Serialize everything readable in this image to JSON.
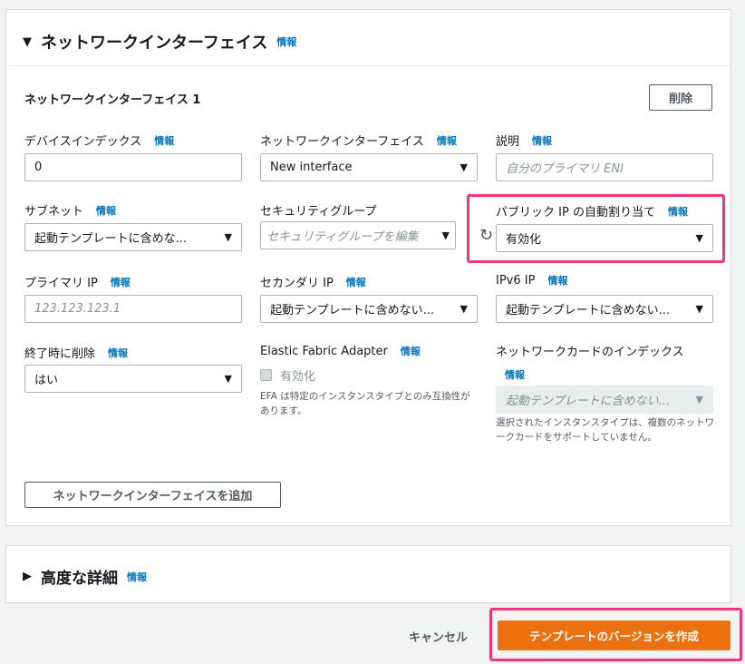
{
  "section": {
    "title": "ネットワークインターフェイス",
    "info": "情報"
  },
  "interface": {
    "title": "ネットワークインターフェイス 1",
    "remove_label": "削除"
  },
  "fields": {
    "device_index": {
      "label": "デバイスインデックス",
      "info": "情報",
      "value": "0"
    },
    "network_interface": {
      "label": "ネットワークインターフェイス",
      "info": "情報",
      "value": "New interface"
    },
    "description": {
      "label": "説明",
      "info": "情報",
      "placeholder": "自分のプライマリ ENI"
    },
    "subnet": {
      "label": "サブネット",
      "info": "情報",
      "value": "起動テンプレートに含めな..."
    },
    "security_group": {
      "label": "セキュリティグループ",
      "placeholder": "セキュリティグループを編集"
    },
    "public_ip": {
      "label": "パブリック IP の自動割り当て",
      "info": "情報",
      "value": "有効化"
    },
    "primary_ip": {
      "label": "プライマリ IP",
      "info": "情報",
      "placeholder": "123.123.123.1"
    },
    "secondary_ip": {
      "label": "セカンダリ IP",
      "info": "情報",
      "value": "起動テンプレートに含めない..."
    },
    "ipv6_ip": {
      "label": "IPv6 IP",
      "info": "情報",
      "value": "起動テンプレートに含めない..."
    },
    "delete_on_termination": {
      "label": "終了時に削除",
      "info": "情報",
      "value": "はい"
    },
    "efa": {
      "label": "Elastic Fabric Adapter",
      "info": "情報",
      "checkbox_label": "有効化",
      "description": "EFA は特定のインスタンスタイプとのみ互換性があります。"
    },
    "network_card_index": {
      "label": "ネットワークカードのインデックス",
      "info": "情報",
      "value": "起動テンプレートに含めない...",
      "description": "選択されたインスタンスタイプは、複数のネットワークカードをサポートしていません。"
    }
  },
  "add_interface_label": "ネットワークインターフェイスを追加",
  "advanced": {
    "title": "高度な詳細",
    "info": "情報"
  },
  "footer": {
    "cancel_label": "キャンセル",
    "create_label": "テンプレートのバージョンを作成"
  },
  "colors": {
    "primary": "#ec7211",
    "link": "#0073bb",
    "highlight": "#f0357b"
  }
}
